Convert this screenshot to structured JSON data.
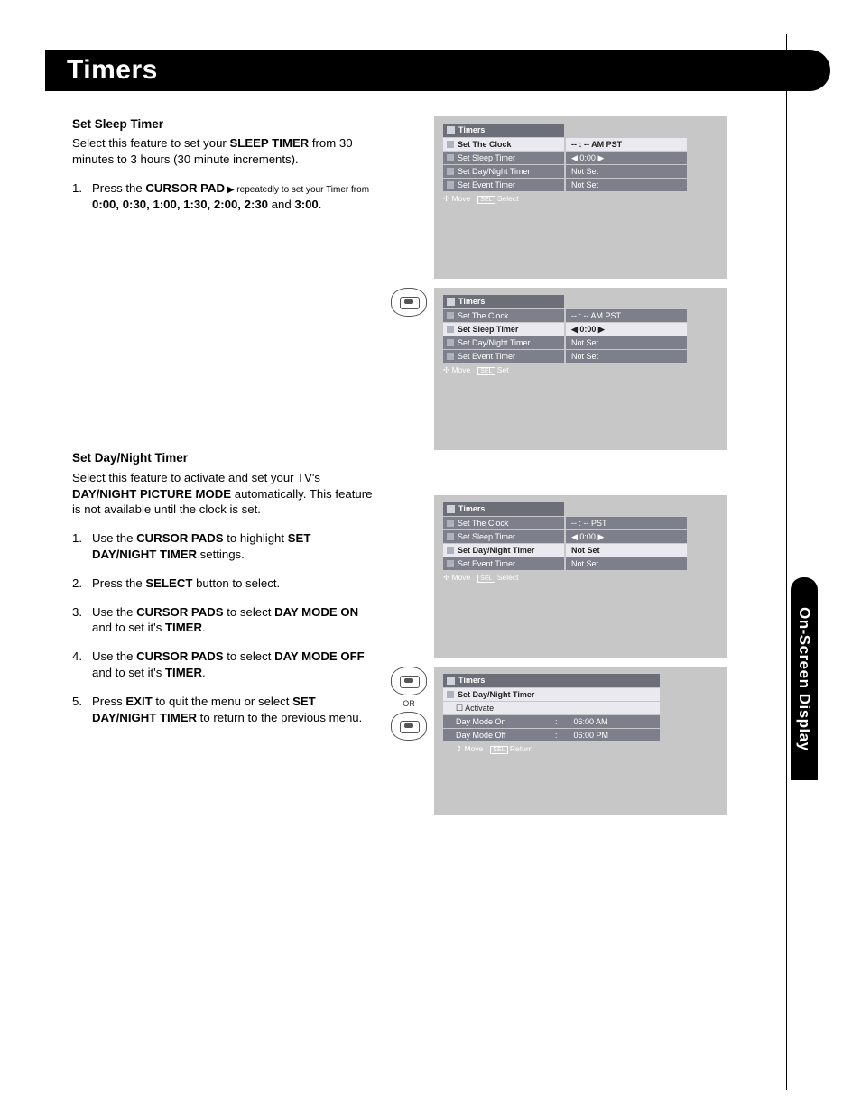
{
  "page_title": "Timers",
  "side_tab": "On-Screen Display",
  "section1": {
    "heading": "Set Sleep Timer",
    "intro_a": "Select this feature to set your ",
    "intro_b": "SLEEP TIMER",
    "intro_c": " from 30 minutes to 3 hours (30 minute increments).",
    "step_num": "1.",
    "step_a": "Press the ",
    "step_b": "CURSOR PAD",
    "step_c": " ▶ repeatedly to set your Timer from ",
    "times": "0:00, 0:30, 1:00, 1:30, 2:00, 2:30",
    "step_d": " and ",
    "times_end": "3:00",
    "step_e": "."
  },
  "section2": {
    "heading": "Set Day/Night Timer",
    "intro_a": "Select this feature to activate and set your TV's ",
    "intro_b": "DAY/NIGHT PICTURE MODE",
    "intro_c": " automatically. This feature is not available until the clock is set.",
    "s1n": "1.",
    "s1a": "Use the ",
    "s1b": "CURSOR PADS",
    "s1c": " to highlight ",
    "s1d": "SET DAY/NIGHT TIMER",
    "s1e": " settings.",
    "s2n": "2.",
    "s2a": "Press the ",
    "s2b": "SELECT",
    "s2c": " button to select.",
    "s3n": "3.",
    "s3a": "Use the ",
    "s3b": "CURSOR PADS",
    "s3c": " to select ",
    "s3d": "DAY MODE ON",
    "s3e": " and to set it's ",
    "s3f": "TIMER",
    "s3g": ".",
    "s4n": "4.",
    "s4a": "Use the ",
    "s4b": "CURSOR PADS",
    "s4c": " to select ",
    "s4d": "DAY MODE OFF",
    "s4e": " and to set it's ",
    "s4f": "TIMER",
    "s4g": ".",
    "s5n": "5.",
    "s5a": "Press ",
    "s5b": "EXIT",
    "s5c": " to quit the menu or select ",
    "s5d": "SET DAY/NIGHT TIMER",
    "s5e": " to return to the previous menu."
  },
  "menu": {
    "title": "Timers",
    "items": [
      "Set The Clock",
      "Set Sleep Timer",
      "Set Day/Night Timer",
      "Set Event Timer"
    ],
    "vals_ampst": "-- : --  AM PST",
    "vals_pst": "-- : --  PST",
    "val_time": "◀ 0:00 ▶",
    "val_time_r": "◀ 0:00 ▶",
    "val_notset": "Not Set",
    "foot_move": "Move",
    "foot_sel_lbl": "SEL",
    "foot_select": "Select",
    "foot_set": "Set",
    "foot_return": "Return",
    "dn_title": "Set Day/Night Timer",
    "dn_activate": "☐ Activate",
    "dn_on_k": "Day Mode On",
    "dn_on_v": "06:00 AM",
    "dn_off_k": "Day Mode Off",
    "dn_off_v": "06:00 PM",
    "colon": ":"
  },
  "or_label": "OR"
}
